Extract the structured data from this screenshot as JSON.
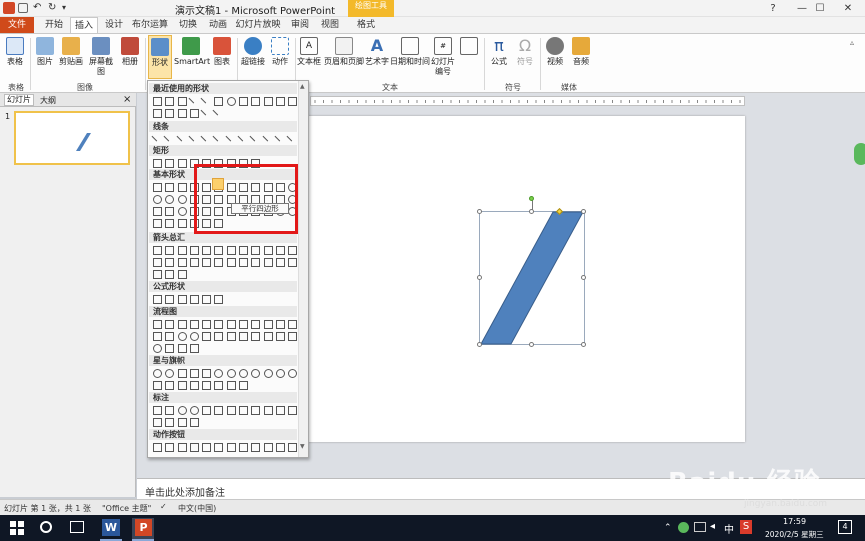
{
  "window": {
    "title": "演示文稿1 - Microsoft PowerPoint",
    "contextual_tab": "绘图工具"
  },
  "tabs": [
    "文件",
    "开始",
    "插入",
    "设计",
    "布尔运算",
    "切换",
    "动画",
    "幻灯片放映",
    "审阅",
    "视图",
    "格式"
  ],
  "ribbon": {
    "buttons": [
      "表格",
      "图片",
      "剪贴画",
      "屏幕截图",
      "相册",
      "形状",
      "SmartArt",
      "图表",
      "超链接",
      "动作",
      "文本框",
      "页眉和页脚",
      "艺术字",
      "日期和时间",
      "幻灯片编号",
      "公式",
      "符号",
      "视频",
      "音频"
    ],
    "groups": [
      "表格",
      "图像",
      "文本",
      "符号",
      "媒体"
    ]
  },
  "left_panel": {
    "tabs": [
      "幻灯片",
      "大纲"
    ],
    "close": "×",
    "slide_number": "1"
  },
  "shapes_gallery": {
    "categories": [
      "最近使用的形状",
      "线条",
      "矩形",
      "基本形状",
      "箭头总汇",
      "公式形状",
      "流程图",
      "星与旗帜",
      "标注",
      "动作按钮"
    ],
    "tooltip": "平行四边形"
  },
  "notes": {
    "placeholder": "单击此处添加备注"
  },
  "status": {
    "slide_info": "幻灯片 第 1 张，共 1 张",
    "theme": "\"Office 主题\"",
    "language": "中文(中国)"
  },
  "taskbar": {
    "ime": "中",
    "ime2": "S",
    "time": "17:59",
    "date": "2020/2/5 星期三",
    "badge": "4"
  },
  "watermark": {
    "logo": "Baidu 经验",
    "url": "jingyan.baidu.com"
  },
  "colors": {
    "accent": "#d04a1a",
    "shape_fill": "#4f81bd",
    "highlight": "#e21818",
    "context": "#f3b92a"
  }
}
